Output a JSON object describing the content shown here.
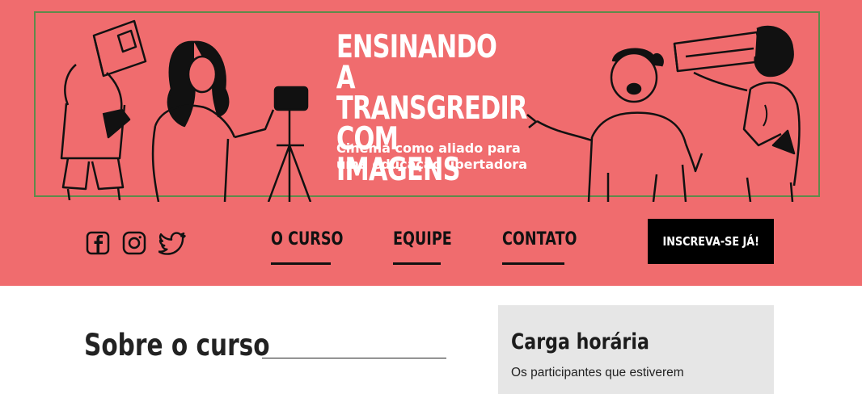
{
  "banner": {
    "title": "ENSINANDO A\nTRANSGREDIR\nCOM IMAGENS",
    "subtitle": "Cinema como aliado para\numa educação libertadora"
  },
  "social": [
    {
      "icon": "facebook-icon"
    },
    {
      "icon": "instagram-icon"
    },
    {
      "icon": "twitter-icon"
    }
  ],
  "nav": {
    "items": [
      {
        "label": "O CURSO"
      },
      {
        "label": "EQUIPE"
      },
      {
        "label": "CONTATO"
      }
    ],
    "cta_label": "INSCREVA-SE JÁ!"
  },
  "main": {
    "about_title": "Sobre o curso",
    "card": {
      "title": "Carga horária",
      "text": "Os participantes que estiverem"
    }
  },
  "colors": {
    "header_bg": "#f06c6e",
    "banner_border": "#5e8a4a",
    "cta_bg": "#000000",
    "card_bg": "#e6e6e6"
  }
}
